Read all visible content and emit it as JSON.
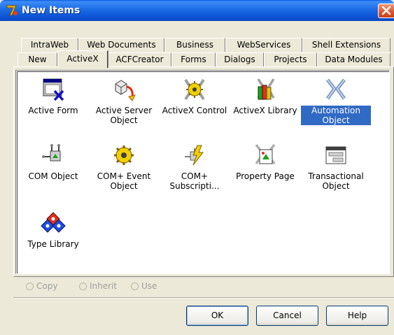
{
  "window": {
    "title": "New Items"
  },
  "tabs": {
    "row_back": [
      "IntraWeb",
      "Web Documents",
      "Business",
      "WebServices",
      "Shell Extensions"
    ],
    "row_front": [
      "New",
      "ActiveX",
      "ACFCreator",
      "Forms",
      "Dialogs",
      "Projects",
      "Data Modules"
    ],
    "active": "ActiveX"
  },
  "items": [
    {
      "label": "Active Form",
      "icon": "active-form-icon"
    },
    {
      "label": "Active Server Object",
      "icon": "active-server-object-icon"
    },
    {
      "label": "ActiveX Control",
      "icon": "activex-control-icon"
    },
    {
      "label": "ActiveX Library",
      "icon": "activex-library-icon"
    },
    {
      "label": "Automation Object",
      "icon": "automation-object-icon",
      "selected": true
    },
    {
      "label": "COM Object",
      "icon": "com-object-icon"
    },
    {
      "label": "COM+ Event Object",
      "icon": "com-event-object-icon"
    },
    {
      "label": "COM+ Subscripti...",
      "icon": "com-subscription-icon"
    },
    {
      "label": "Property Page",
      "icon": "property-page-icon"
    },
    {
      "label": "Transactional Object",
      "icon": "transactional-object-icon"
    },
    {
      "label": "Type Library",
      "icon": "type-library-icon"
    }
  ],
  "options": {
    "copy": "Copy",
    "inherit": "Inherit",
    "use": "Use"
  },
  "buttons": {
    "ok": "OK",
    "cancel": "Cancel",
    "help": "Help"
  },
  "colors": {
    "titlebar": "#0b53d6",
    "selection": "#316ac5",
    "close": "#e0532a"
  }
}
